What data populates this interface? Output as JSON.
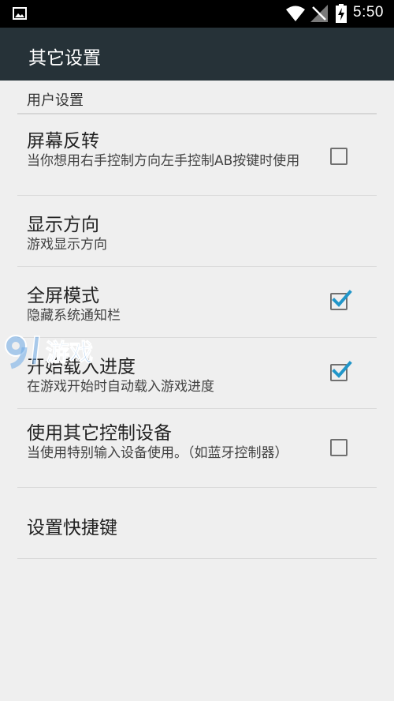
{
  "status_bar": {
    "time": "5:50",
    "icons": [
      "gallery-icon",
      "wifi-icon",
      "signal-icon",
      "battery-charging-icon"
    ]
  },
  "app_bar": {
    "title": "其它设置"
  },
  "section": {
    "header": "用户设置"
  },
  "preferences": [
    {
      "title": "屏幕反转",
      "summary": "当你想用右手控制方向左手控制AB按键时使用",
      "checkbox": "unchecked"
    },
    {
      "title": "显示方向",
      "summary": "游戏显示方向"
    },
    {
      "title": "全屏模式",
      "summary": "隐藏系统通知栏",
      "checkbox": "checked"
    },
    {
      "title": "开始载入进度",
      "summary": "在游戏开始时自动载入游戏进度",
      "checkbox": "checked"
    },
    {
      "title": "使用其它控制设备",
      "summary": "当使用特别输入设备使用。（如蓝牙控制器）",
      "checkbox": "unchecked"
    },
    {
      "title": "设置快捷键"
    }
  ],
  "watermark": {
    "text": "9游戏"
  },
  "colors": {
    "app_bar": "#263238",
    "status_bar": "#000000",
    "background": "#efefef",
    "accent_check": "#2196c9"
  }
}
